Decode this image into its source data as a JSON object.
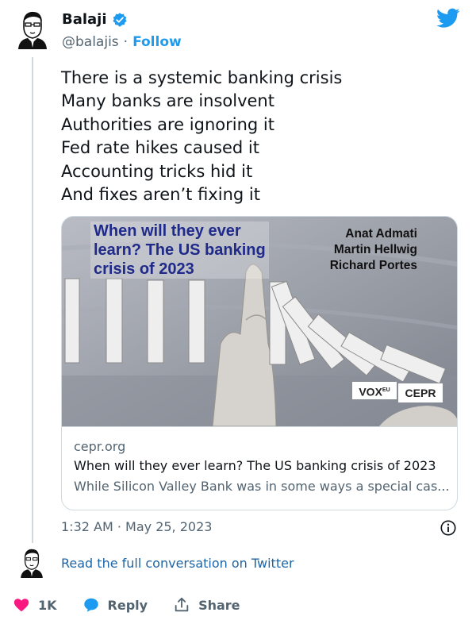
{
  "author": {
    "name": "Balaji",
    "handle": "@balajis",
    "follow_label": "Follow",
    "verified": true
  },
  "tweet": {
    "lines": [
      "There is a systemic banking crisis",
      "Many banks are insolvent",
      "Authorities are ignoring it",
      "Fed rate hikes caused it",
      "Accounting tricks hid it",
      "And fixes aren’t fixing it"
    ],
    "timestamp": "1:32 AM · May 25, 2023"
  },
  "card": {
    "image_headline": [
      "When will they ever",
      "learn? The US banking",
      "crisis of 2023"
    ],
    "image_authors": [
      "Anat Admati",
      "Martin Hellwig",
      "Richard Portes"
    ],
    "image_logos": {
      "vox": "VOX",
      "vox_sup": "EU",
      "cepr": "CEPR"
    },
    "domain": "cepr.org",
    "title": "When will they ever learn? The US banking crisis of 2023",
    "description": "While Silicon Valley Bank was in some ways a special cas..."
  },
  "conversation_link": "Read the full conversation on Twitter",
  "actions": {
    "likes": "1K",
    "reply": "Reply",
    "share": "Share"
  },
  "colors": {
    "twitter_blue": "#1d9bf0",
    "like_red": "#f91880",
    "headline_navy": "#1f2a8a"
  }
}
